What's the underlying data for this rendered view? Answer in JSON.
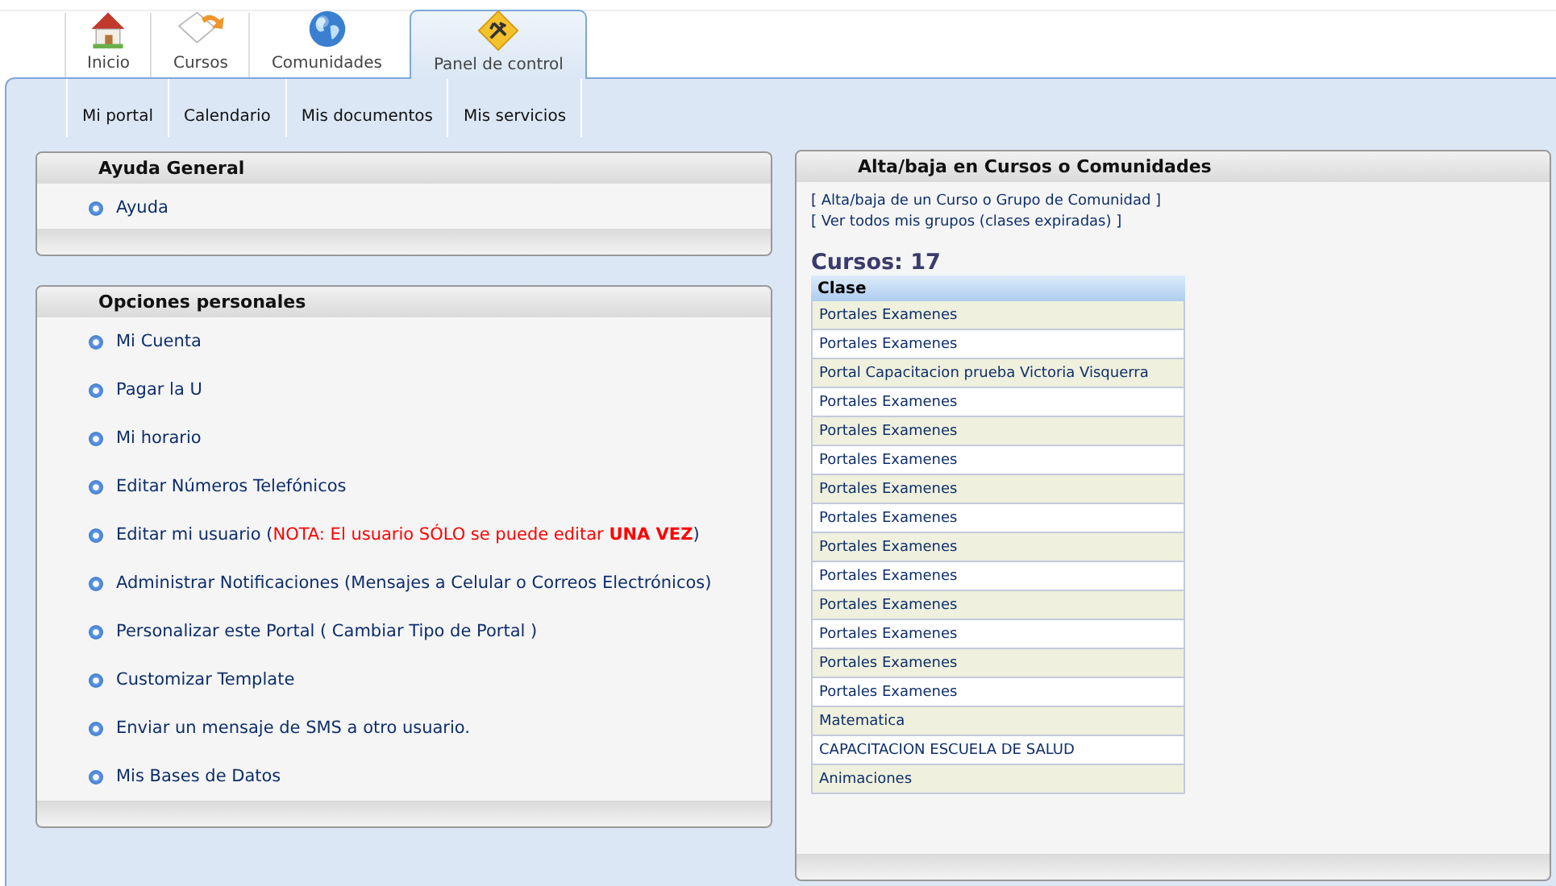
{
  "tabs": [
    {
      "label": "Inicio",
      "selected": false
    },
    {
      "label": "Cursos",
      "selected": false
    },
    {
      "label": "Comunidades",
      "selected": false
    },
    {
      "label": "Panel de control",
      "selected": true
    }
  ],
  "subnav": [
    "Mi portal",
    "Calendario",
    "Mis documentos",
    "Mis servicios"
  ],
  "help_panel": {
    "title": "Ayuda General",
    "items": [
      {
        "label": "Ayuda"
      }
    ]
  },
  "options_panel": {
    "title": "Opciones personales",
    "items": [
      {
        "label": "Mi Cuenta"
      },
      {
        "label": "Pagar la U"
      },
      {
        "label": "Mi horario"
      },
      {
        "label": "Editar Números Telefónicos"
      },
      {
        "label": "Editar mi usuario (",
        "note": "NOTA: El usuario SÓLO se puede editar **UNA VEZ**",
        "label_end": ")"
      },
      {
        "label": "Administrar Notificaciones (Mensajes a Celular o Correos Electrónicos)"
      },
      {
        "label": "Personalizar este Portal ( Cambiar Tipo de Portal )"
      },
      {
        "label": "Customizar Template"
      },
      {
        "label": "Enviar un mensaje de SMS a otro usuario."
      },
      {
        "label": "Mis Bases de Datos"
      }
    ]
  },
  "courses_panel": {
    "title": "Alta/baja en Cursos o Comunidades",
    "links": [
      "[ Alta/baja de un Curso o Grupo de Comunidad ]",
      "[ Ver todos mis grupos (clases expiradas) ]"
    ],
    "count_label": "Cursos: 17",
    "table": {
      "columns": [
        "Clase"
      ],
      "rows": [
        "Portales Examenes",
        "Portales Examenes",
        "Portal Capacitacion prueba Victoria Visquerra",
        "Portales Examenes",
        "Portales Examenes",
        "Portales Examenes",
        "Portales Examenes",
        "Portales Examenes",
        "Portales Examenes",
        "Portales Examenes",
        "Portales Examenes",
        "Portales Examenes",
        "Portales Examenes",
        "Portales Examenes",
        "Matematica",
        "CAPACITACION ESCUELA DE SALUD",
        "Animaciones"
      ]
    }
  }
}
